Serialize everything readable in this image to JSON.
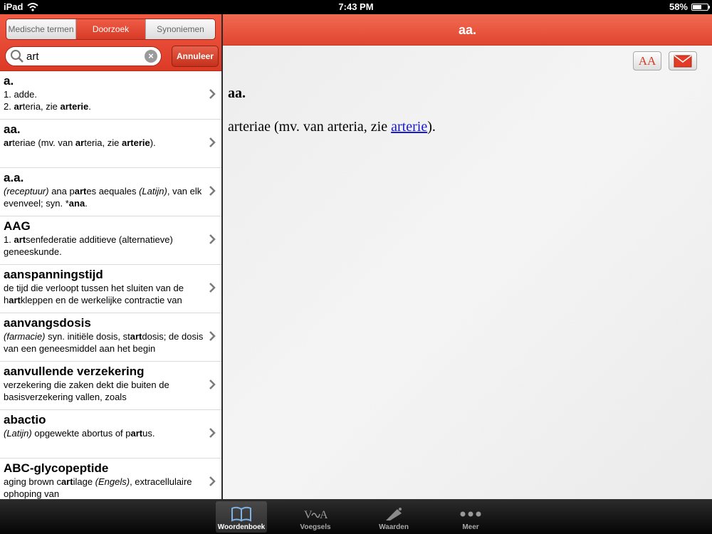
{
  "status_bar": {
    "device": "iPad",
    "time": "7:43 PM",
    "battery": "58%",
    "battery_level": 0.58
  },
  "left": {
    "segments": [
      {
        "label": "Medische termen",
        "active": false
      },
      {
        "label": "Doorzoek",
        "active": true
      },
      {
        "label": "Synoniemen",
        "active": false
      }
    ],
    "search": {
      "value": "art",
      "placeholder": ""
    },
    "cancel_label": "Annuleer",
    "results": [
      {
        "term": "a.",
        "html": "1. adde.<br>2. <b>ar</b>teria, zie <b>arterie</b>."
      },
      {
        "term": "aa.",
        "html": "<b>ar</b>teriae (mv. van <b>ar</b>teria, zie <b>arterie</b>)."
      },
      {
        "term": "a.a.",
        "html": "<i>(receptuur)</i> ana p<b>art</b>es aequales <i>(Latijn)</i>, van elk evenveel; syn. *<b>ana</b>."
      },
      {
        "term": "AAG",
        "html": "1. <b>art</b>senfederatie additieve (alternatieve) geneeskunde."
      },
      {
        "term": "aanspanningstijd",
        "html": "de tijd die verloopt tussen het sluiten van de h<b>art</b>kleppen en de werkelijke contractie van"
      },
      {
        "term": "aanvangsdosis",
        "html": "<i>(farmacie)</i> syn. initiële dosis, st<b>art</b>dosis; de dosis van een geneesmiddel aan het begin"
      },
      {
        "term": "aanvullende verzekering",
        "html": "verzekering die zaken dekt die buiten de basisverzekering vallen, zoals"
      },
      {
        "term": "abactio",
        "html": "<i>(Latijn)</i> opgewekte abortus of p<b>art</b>us."
      },
      {
        "term": "ABC-glycopeptide",
        "html": "aging brown c<b>art</b>ilage <i>(Engels)</i>, extracellulaire ophoping van"
      }
    ]
  },
  "right": {
    "title": "aa.",
    "font_button": "AA",
    "entry_headword": "aa.",
    "entry_pre": "arteriae (mv. van arteria, zie ",
    "entry_link": "arterie",
    "entry_post": ")."
  },
  "tabbar": {
    "tabs": [
      {
        "label": "Woordenboek",
        "icon": "book-icon",
        "active": true
      },
      {
        "label": "Voegsels",
        "icon": "affix-icon",
        "active": false
      },
      {
        "label": "Waarden",
        "icon": "flask-icon",
        "active": false
      },
      {
        "label": "Meer",
        "icon": "more-dots-icon",
        "active": false
      }
    ]
  },
  "colors": {
    "accent": "#e8452f",
    "link": "#1a1ad0"
  }
}
